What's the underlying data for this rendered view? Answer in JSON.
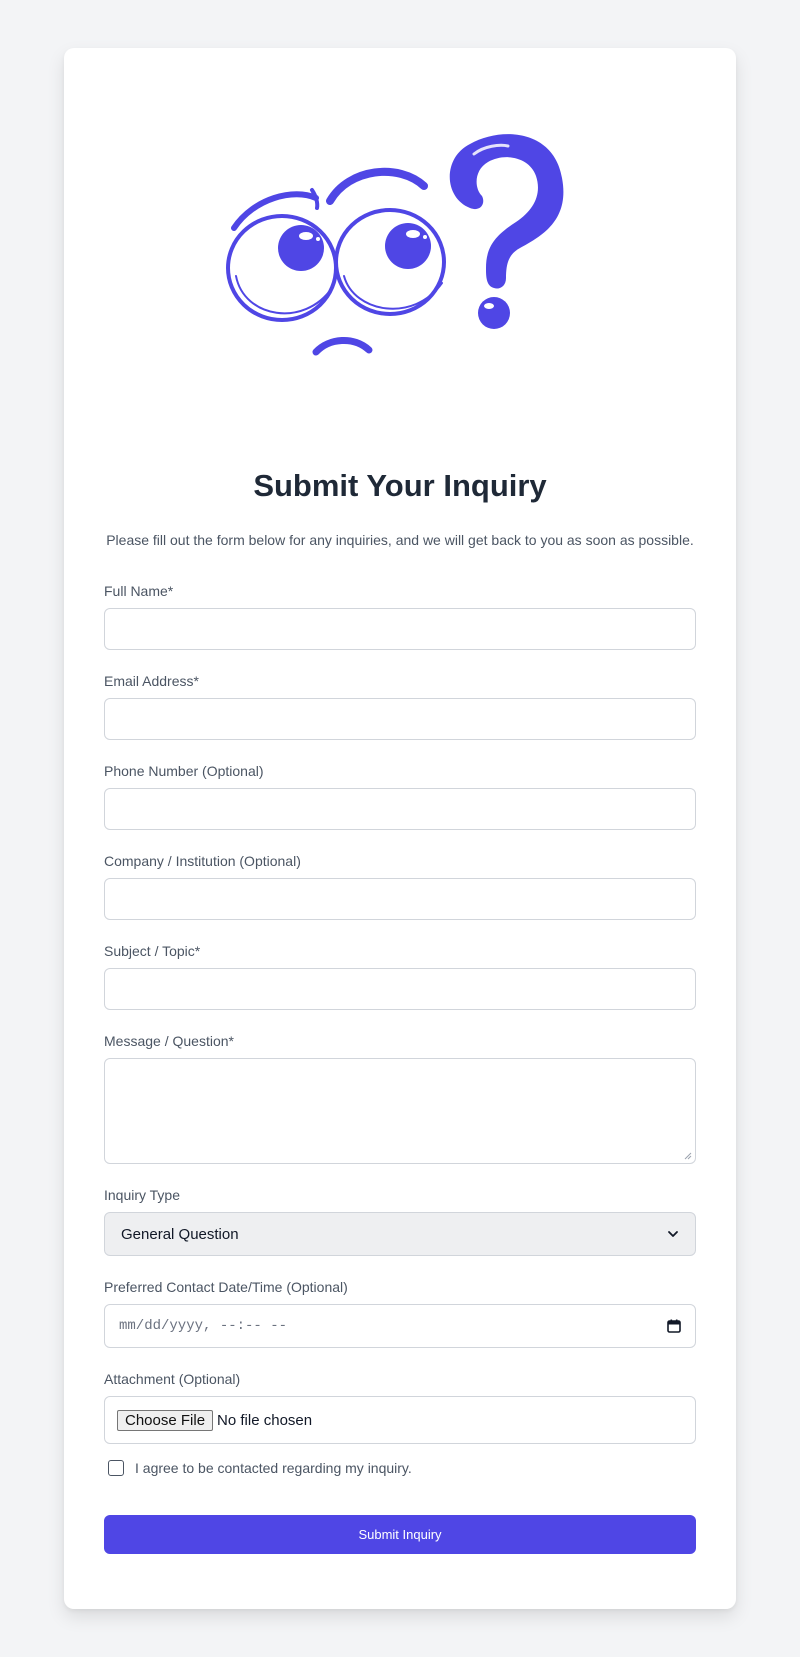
{
  "form": {
    "title": "Submit Your Inquiry",
    "subtitle": "Please fill out the form below for any inquiries, and we will get back to you as soon as possible.",
    "fields": [
      {
        "label": "Full Name*",
        "value": "",
        "placeholder": ""
      },
      {
        "label": "Email Address*",
        "value": "",
        "placeholder": ""
      },
      {
        "label": "Phone Number (Optional)",
        "value": "",
        "placeholder": ""
      },
      {
        "label": "Company / Institution (Optional)",
        "value": "",
        "placeholder": ""
      },
      {
        "label": "Subject / Topic*",
        "value": "",
        "placeholder": ""
      }
    ],
    "message": {
      "label": "Message / Question*",
      "value": ""
    },
    "inquiry_type": {
      "label": "Inquiry Type",
      "selected": "General Question"
    },
    "contact_datetime": {
      "label": "Preferred Contact Date/Time (Optional)",
      "placeholder": "mm/dd/yyyy, --:-- --"
    },
    "attachment": {
      "label": "Attachment (Optional)",
      "button_label": "Choose File",
      "status": "No file chosen"
    },
    "consent": {
      "label": "I agree to be contacted regarding my inquiry.",
      "checked": false
    },
    "submit_label": "Submit Inquiry"
  },
  "icons": {
    "illustration": "confused-eyes-question-mark-icon",
    "select": "chevron-down-icon",
    "date": "calendar-icon"
  },
  "colors": {
    "accent": "#4f46e5",
    "page_background": "#f3f4f6",
    "card_background": "#ffffff",
    "title": "#1f2937"
  }
}
